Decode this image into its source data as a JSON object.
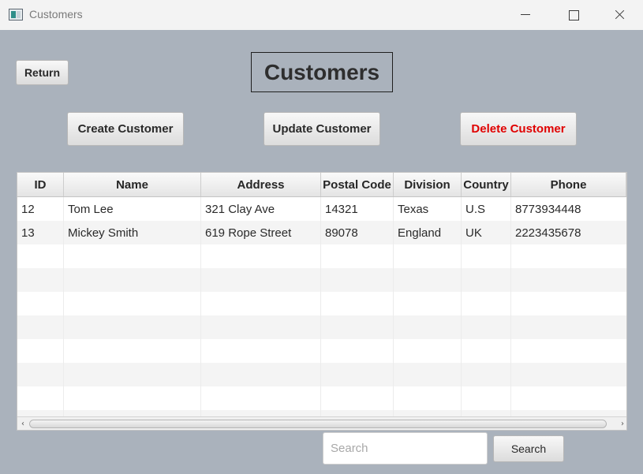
{
  "window": {
    "title": "Customers",
    "controls": [
      "minimize",
      "maximize",
      "close"
    ]
  },
  "header": {
    "heading": "Customers",
    "return_label": "Return"
  },
  "toolbar": {
    "create_label": "Create Customer",
    "update_label": "Update Customer",
    "delete_label": "Delete Customer"
  },
  "table": {
    "columns": [
      "ID",
      "Name",
      "Address",
      "Postal Code",
      "Division",
      "Country",
      "Phone"
    ],
    "rows": [
      [
        "12",
        "Tom Lee",
        "321 Clay Ave",
        "14321",
        "Texas",
        "U.S",
        "8773934448"
      ],
      [
        "13",
        "Mickey Smith",
        "619 Rope Street",
        "89078",
        "England",
        "UK",
        "2223435678"
      ]
    ]
  },
  "search": {
    "placeholder": "Search",
    "value": "",
    "button_label": "Search"
  },
  "colors": {
    "background": "#aab2bc",
    "delete_text": "#e00000",
    "title_bar": "#f3f3f3"
  },
  "icons": {
    "app": "app-window-icon",
    "scroll_left": "chevron-left-icon",
    "scroll_right": "chevron-right-icon"
  }
}
